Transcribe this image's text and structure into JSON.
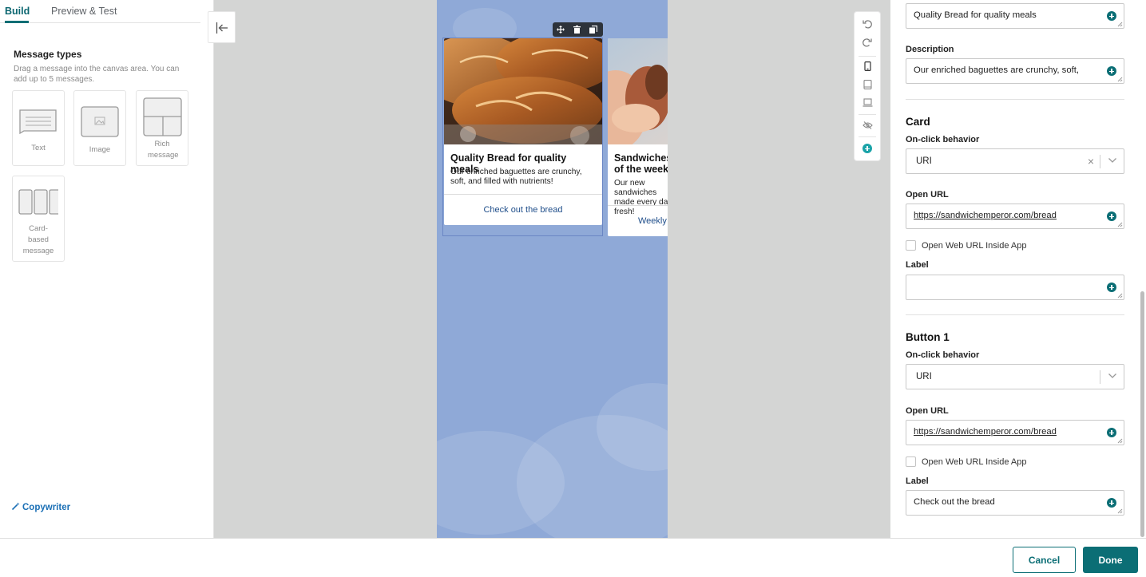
{
  "tabs": {
    "build": "Build",
    "preview": "Preview & Test"
  },
  "message_types": {
    "title": "Message types",
    "help": "Drag a message into the canvas area. You can add up to 5 messages.",
    "items": [
      {
        "label": "Text"
      },
      {
        "label": "Image"
      },
      {
        "label": "Rich message"
      },
      {
        "label": "Card-based message"
      }
    ]
  },
  "copywriter": "Copywriter",
  "canvas": {
    "cards": [
      {
        "title": "Quality Bread for quality meals",
        "description": "Our enriched baguettes are crunchy, soft, and filled with nutrients!",
        "button": "Check out the bread"
      },
      {
        "title": "Sandwiches of the week",
        "description": "Our new sandwiches made every day fresh!",
        "button": "Weekly"
      }
    ]
  },
  "right": {
    "title_value": "Quality Bread for quality meals",
    "description_label": "Description",
    "description_value": "Our enriched baguettes are crunchy, soft,",
    "card": {
      "heading": "Card",
      "onclick_label": "On-click behavior",
      "onclick_value": "URI",
      "open_url_label": "Open URL",
      "open_url_value": "https://sandwichemperor.com/bread",
      "web_inside_label": "Open Web URL Inside App",
      "label_label": "Label",
      "label_value": ""
    },
    "button1": {
      "heading": "Button 1",
      "onclick_label": "On-click behavior",
      "onclick_value": "URI",
      "open_url_label": "Open URL",
      "open_url_value": "https://sandwichemperor.com/bread",
      "web_inside_label": "Open Web URL Inside App",
      "label_label": "Label",
      "label_value": "Check out the bread"
    }
  },
  "footer": {
    "cancel": "Cancel",
    "done": "Done"
  },
  "colors": {
    "accent": "#0b6e75",
    "canvas_bg": "#8fa9d7",
    "link": "#1a6fb5"
  }
}
